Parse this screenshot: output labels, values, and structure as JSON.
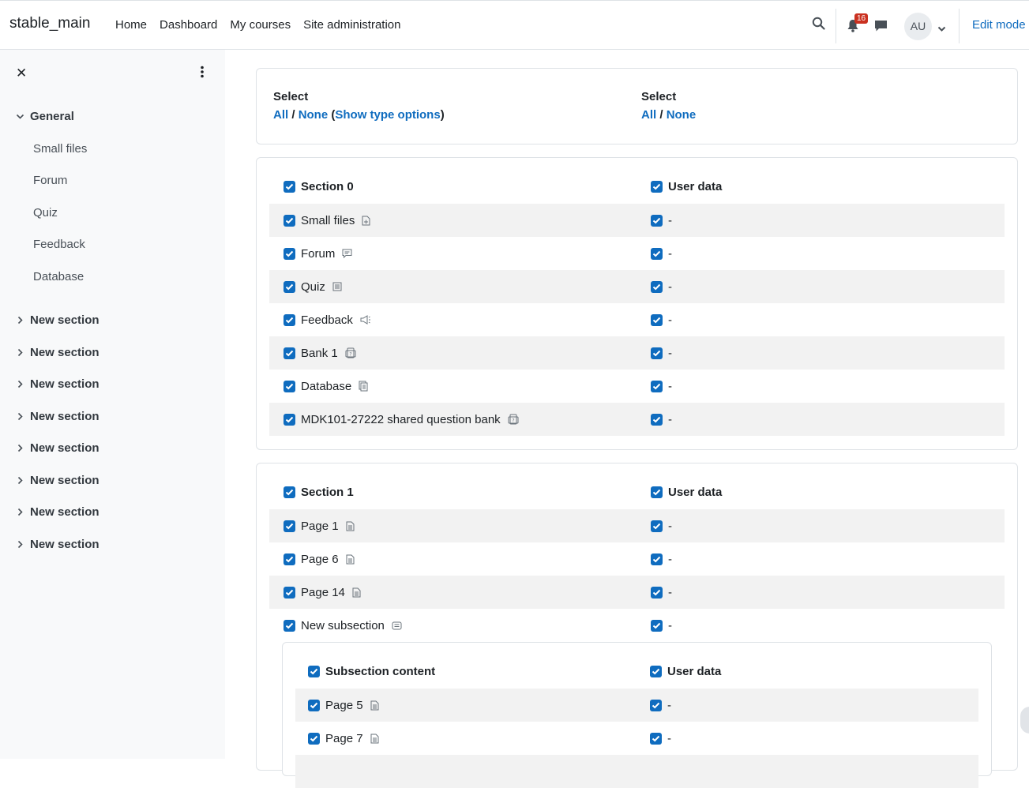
{
  "navbar": {
    "brand": "stable_main",
    "links": [
      "Home",
      "Dashboard",
      "My courses",
      "Site administration"
    ],
    "notification_count": "16",
    "avatar_initials": "AU",
    "edit_mode_label": "Edit mode",
    "icons": [
      "search-icon",
      "bell-icon",
      "chat-icon",
      "chevron-down-icon"
    ]
  },
  "drawer": {
    "close_icon": "close-icon",
    "menu_icon": "kebab-icon",
    "general": {
      "title": "General",
      "items": [
        "Small files",
        "Forum",
        "Quiz",
        "Feedback",
        "Database"
      ]
    },
    "sections": [
      "New section",
      "New section",
      "New section",
      "New section",
      "New section",
      "New section",
      "New section",
      "New section"
    ]
  },
  "select_card": {
    "left_title": "Select",
    "left_all": "All",
    "left_sep": "/",
    "left_none": "None",
    "left_show_type": "Show type options",
    "right_title": "Select",
    "right_all": "All",
    "right_sep": "/",
    "right_none": "None"
  },
  "section0": {
    "title": "Section 0",
    "user_data_label": "User data",
    "rows": [
      {
        "name": "Small files",
        "icon": "file-icon",
        "user": "-"
      },
      {
        "name": "Forum",
        "icon": "forum-icon",
        "user": "-"
      },
      {
        "name": "Quiz",
        "icon": "quiz-icon",
        "user": "-"
      },
      {
        "name": "Feedback",
        "icon": "megaphone-icon",
        "user": "-"
      },
      {
        "name": "Bank 1",
        "icon": "question-bank-icon",
        "user": "-"
      },
      {
        "name": "Database",
        "icon": "database-icon",
        "user": "-"
      },
      {
        "name": "MDK101-27222 shared question bank",
        "icon": "question-bank-icon",
        "user": "-"
      }
    ]
  },
  "section1": {
    "title": "Section 1",
    "user_data_label": "User data",
    "rows": [
      {
        "name": "Page 1",
        "icon": "page-icon",
        "user": "-"
      },
      {
        "name": "Page 6",
        "icon": "page-icon",
        "user": "-"
      },
      {
        "name": "Page 14",
        "icon": "page-icon",
        "user": "-"
      },
      {
        "name": "New subsection",
        "icon": "subsection-icon",
        "user": "-"
      }
    ],
    "subsection": {
      "title": "Subsection content",
      "user_data_label": "User data",
      "rows": [
        {
          "name": "Page 5",
          "icon": "page-icon",
          "user": "-"
        },
        {
          "name": "Page 7",
          "icon": "page-icon",
          "user": "-"
        }
      ]
    }
  }
}
